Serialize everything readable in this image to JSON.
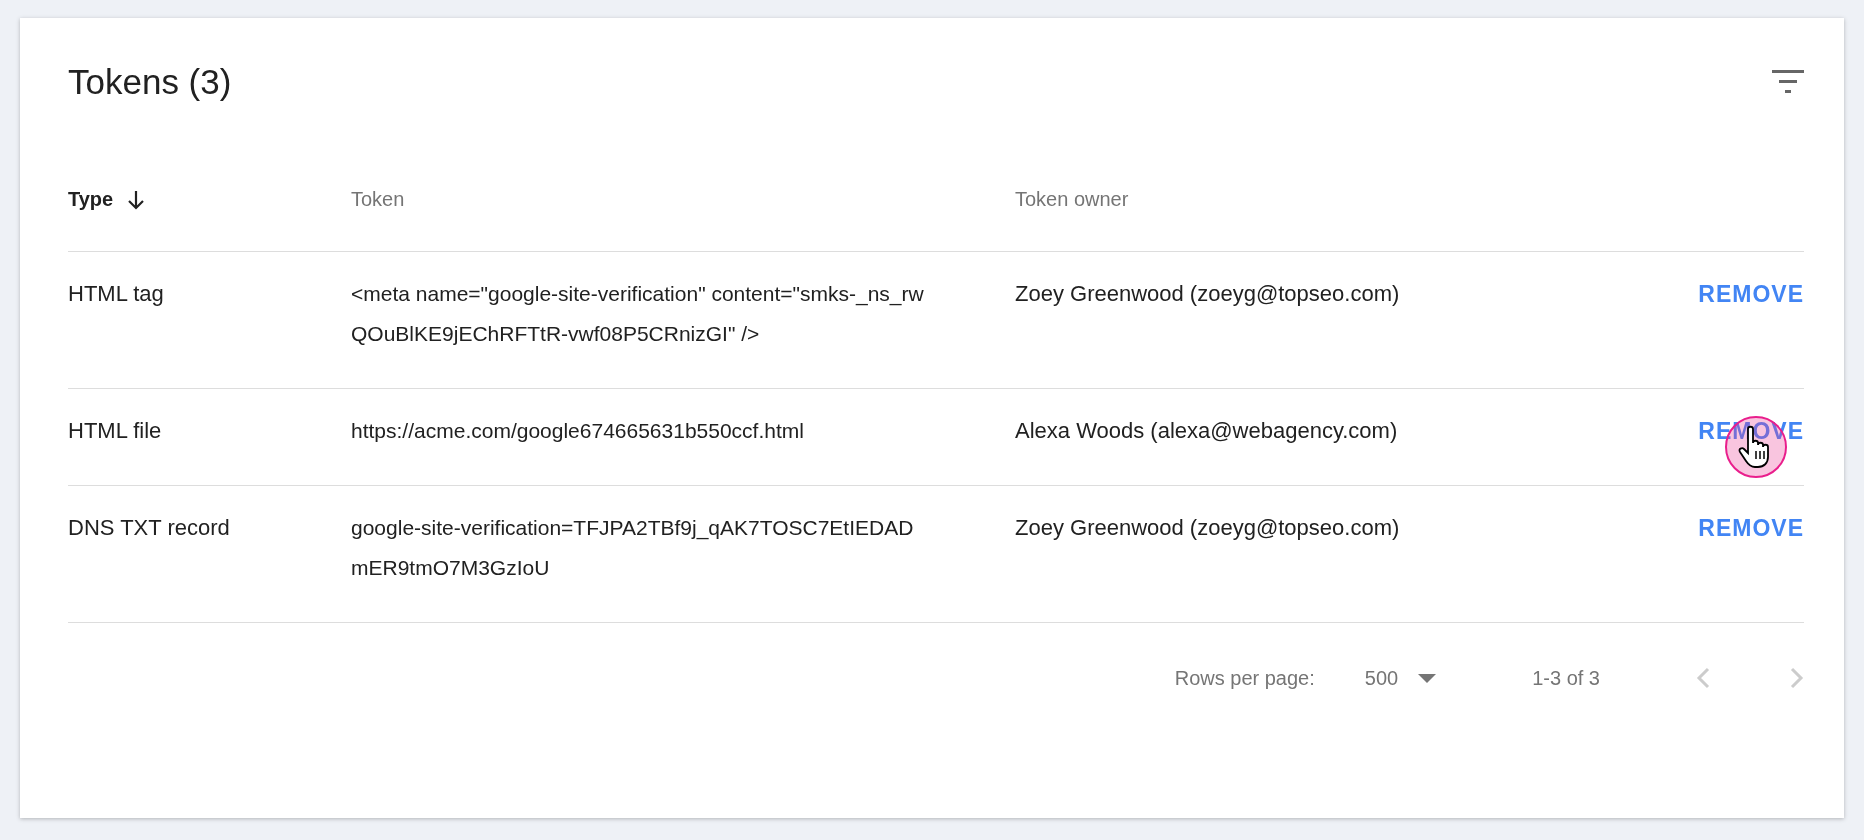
{
  "card": {
    "title": "Tokens (3)"
  },
  "table": {
    "columns": [
      {
        "label": "Type",
        "sorted": true
      },
      {
        "label": "Token",
        "sorted": false
      },
      {
        "label": "Token owner",
        "sorted": false
      }
    ],
    "rows": [
      {
        "type": "HTML tag",
        "token": "<meta name=\"google-site-verification\" content=\"smks-_ns_rwQOuBlKE9jEChRFTtR-vwf08P5CRnizGI\" />",
        "owner": "Zoey Greenwood (zoeyg@topseo.com)",
        "action": "REMOVE",
        "pointer": false
      },
      {
        "type": "HTML file",
        "token": "https://acme.com/google674665631b550ccf.html",
        "owner": "Alexa Woods (alexa@webagency.com)",
        "action": "REMOVE",
        "pointer": true
      },
      {
        "type": "DNS TXT record",
        "token": "google-site-verification=TFJPA2TBf9j_qAK7TOSC7EtIEDADmER9tmO7M3GzIoU",
        "owner": "Zoey Greenwood (zoeyg@topseo.com)",
        "action": "REMOVE",
        "pointer": false
      }
    ]
  },
  "pagination": {
    "rows_per_page_label": "Rows per page:",
    "rows_per_page": "500",
    "range": "1-3 of 3",
    "prev_disabled": true,
    "next_disabled": true
  }
}
